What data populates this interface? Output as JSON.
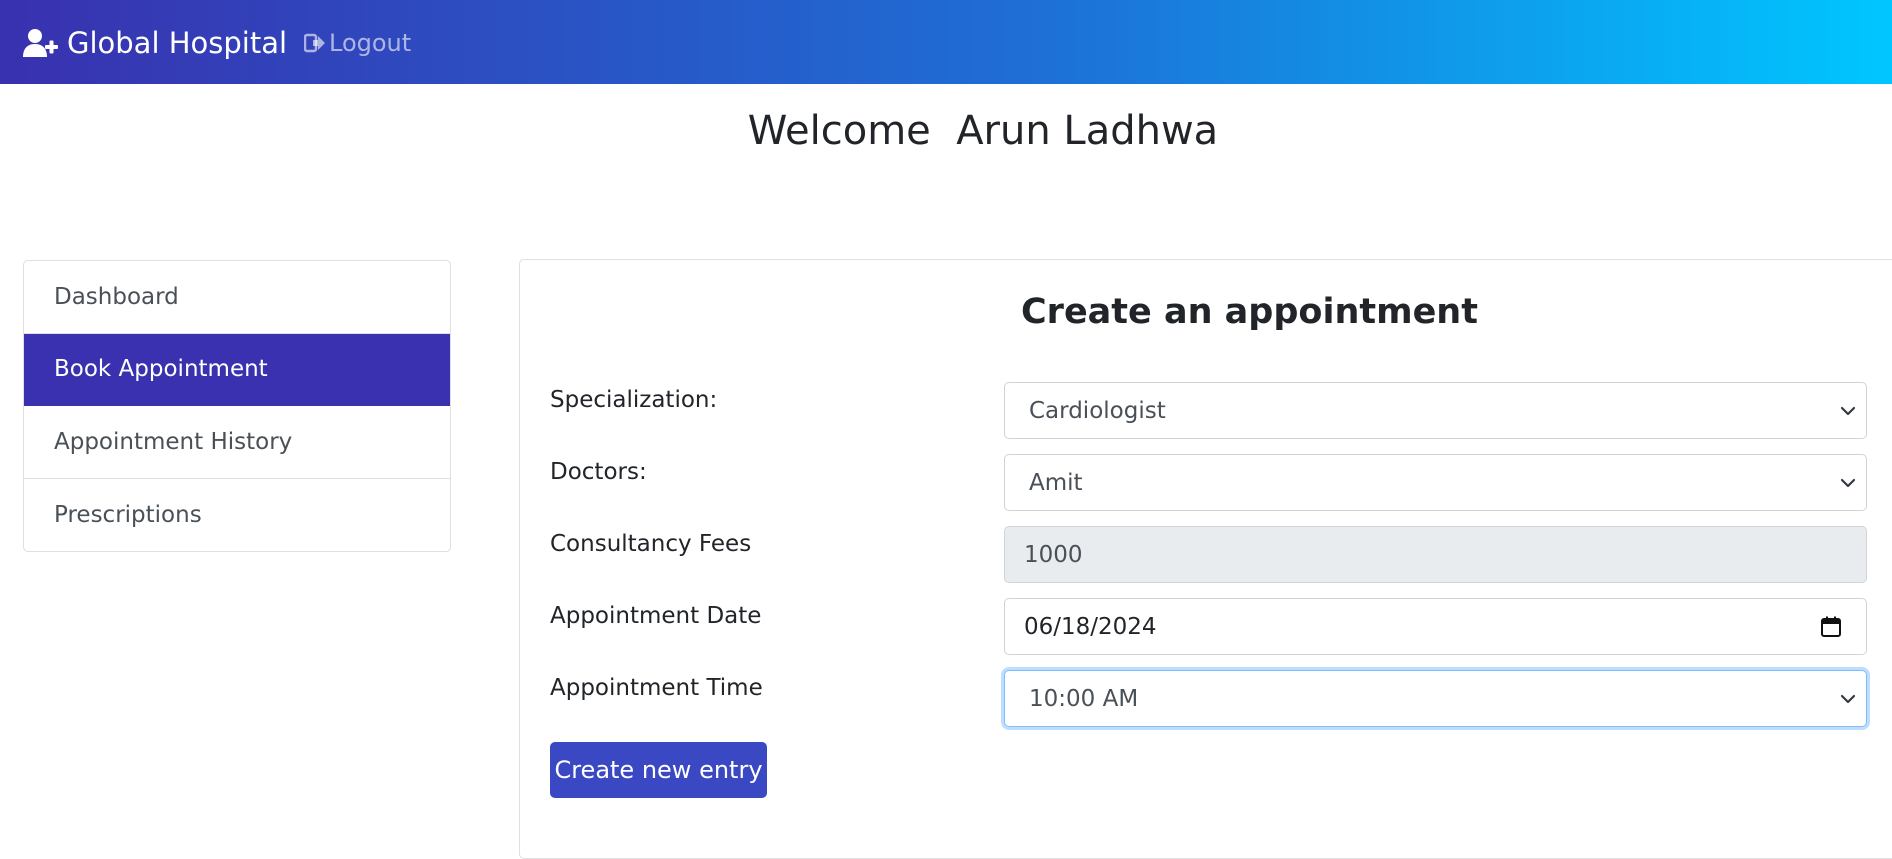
{
  "navbar": {
    "brand": "Global Hospital",
    "logout": "Logout",
    "gradient": [
      "#3931af",
      "#00c6ff"
    ]
  },
  "welcome": {
    "text": "Welcome  Arun Ladhwa"
  },
  "sidebar": {
    "active_color": "#3931af",
    "items": [
      {
        "label": "Dashboard",
        "active": false
      },
      {
        "label": "Book Appointment",
        "active": true
      },
      {
        "label": "Appointment History",
        "active": false
      },
      {
        "label": "Prescriptions",
        "active": false
      }
    ]
  },
  "form": {
    "title": "Create an appointment",
    "specialization": {
      "label": "Specialization:",
      "value": "Cardiologist"
    },
    "doctors": {
      "label": "Doctors:",
      "value": "Amit"
    },
    "fees": {
      "label": "Consultancy Fees",
      "value": "1000"
    },
    "date": {
      "label": "Appointment Date",
      "value": "06/18/2024"
    },
    "time": {
      "label": "Appointment Time",
      "value": "10:00 AM"
    },
    "submit_label": "Create new entry",
    "submit_color": "#3a48c4"
  }
}
